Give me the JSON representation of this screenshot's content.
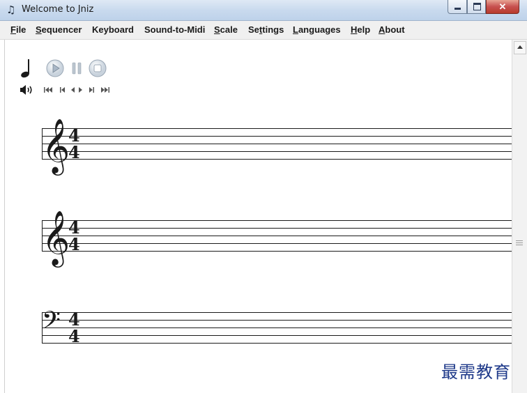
{
  "window": {
    "title": "Welcome to Jniz",
    "close_glyph": "✕"
  },
  "menu": [
    {
      "label": "File",
      "u": "F",
      "rest": "ile"
    },
    {
      "label": "Sequencer",
      "u": "S",
      "rest": "equencer"
    },
    {
      "label": "Keyboard",
      "u": "",
      "rest": "Keyboard"
    },
    {
      "label": "Sound-to-Midi",
      "u": "",
      "rest": "Sound-to-Midi"
    },
    {
      "label": "Scale",
      "u": "S",
      "rest": "cale"
    },
    {
      "label": "Settings",
      "pre": "Se",
      "u": "t",
      "rest": "tings"
    },
    {
      "label": "Languages",
      "u": "L",
      "rest": "anguages"
    },
    {
      "label": "Help",
      "u": "H",
      "rest": "elp"
    },
    {
      "label": "About",
      "u": "A",
      "rest": "bout"
    }
  ],
  "toolbar": {
    "note_icon": "quarter-note-icon",
    "play_icon": "play-icon",
    "pause_icon": "pause-icon",
    "stop_icon": "stop-icon",
    "volume_icon": "speaker-icon",
    "transport": [
      "rewind-icon",
      "skip-back-icon",
      "step-back-icon",
      "step-forward-icon",
      "skip-forward-icon",
      "fast-forward-icon"
    ]
  },
  "staves": [
    {
      "clef": "treble",
      "time_signature": {
        "numerator": "4",
        "denominator": "4"
      }
    },
    {
      "clef": "treble",
      "time_signature": {
        "numerator": "4",
        "denominator": "4"
      }
    },
    {
      "clef": "bass",
      "time_signature": {
        "numerator": "4",
        "denominator": "4"
      }
    }
  ],
  "watermark": "最需教育",
  "colors": {
    "titlebar": "#c9daee",
    "menubar": "#f0f0f0",
    "close_button": "#c75050",
    "watermark": "#1f3a8a",
    "ink": "#1a1a1a"
  }
}
